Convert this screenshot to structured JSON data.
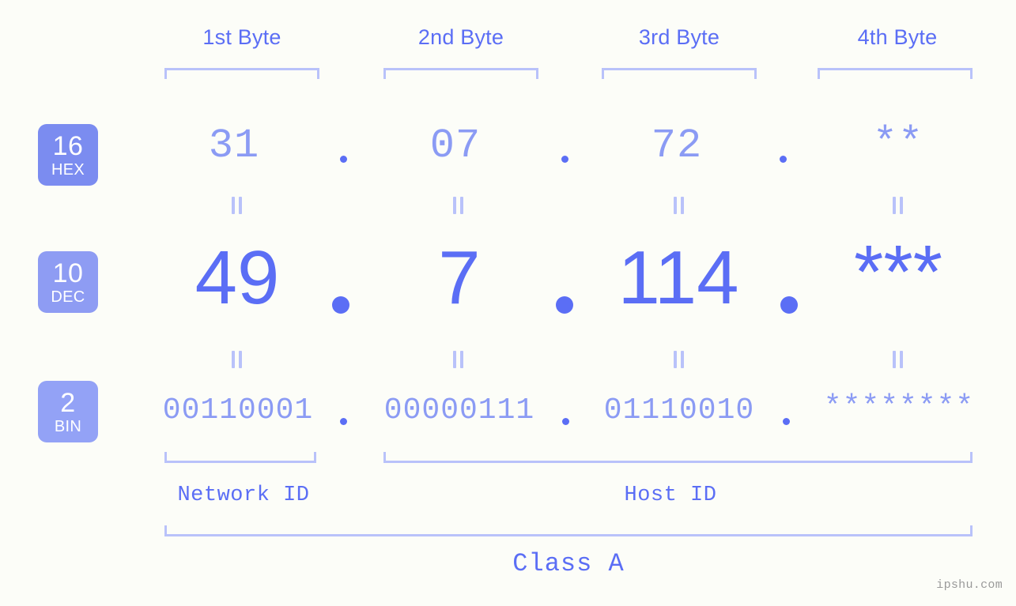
{
  "background_color": "#fcfdf8",
  "accent_color": "#5b6ef5",
  "muted_accent_color": "#8b9bf4",
  "bracket_color": "#b9c2fa",
  "byte_headers": [
    {
      "label": "1st Byte"
    },
    {
      "label": "2nd Byte"
    },
    {
      "label": "3rd Byte"
    },
    {
      "label": "4th Byte"
    }
  ],
  "rows": {
    "hex": {
      "badge_number": "16",
      "badge_name": "HEX",
      "badge_color": "#7b8cf0",
      "values": [
        "31",
        "07",
        "72",
        "**"
      ]
    },
    "dec": {
      "badge_number": "10",
      "badge_name": "DEC",
      "badge_color": "#8e9cf3",
      "values": [
        "49",
        "7",
        "114",
        "***"
      ]
    },
    "bin": {
      "badge_number": "2",
      "badge_name": "BIN",
      "badge_color": "#93a2f6",
      "values": [
        "00110001",
        "00000111",
        "01110010",
        "********"
      ]
    }
  },
  "separator": ".",
  "equivalence_marker": "=",
  "footer": {
    "network_id_label": "Network ID",
    "host_id_label": "Host ID",
    "class_label": "Class A"
  },
  "watermark": "ipshu.com"
}
